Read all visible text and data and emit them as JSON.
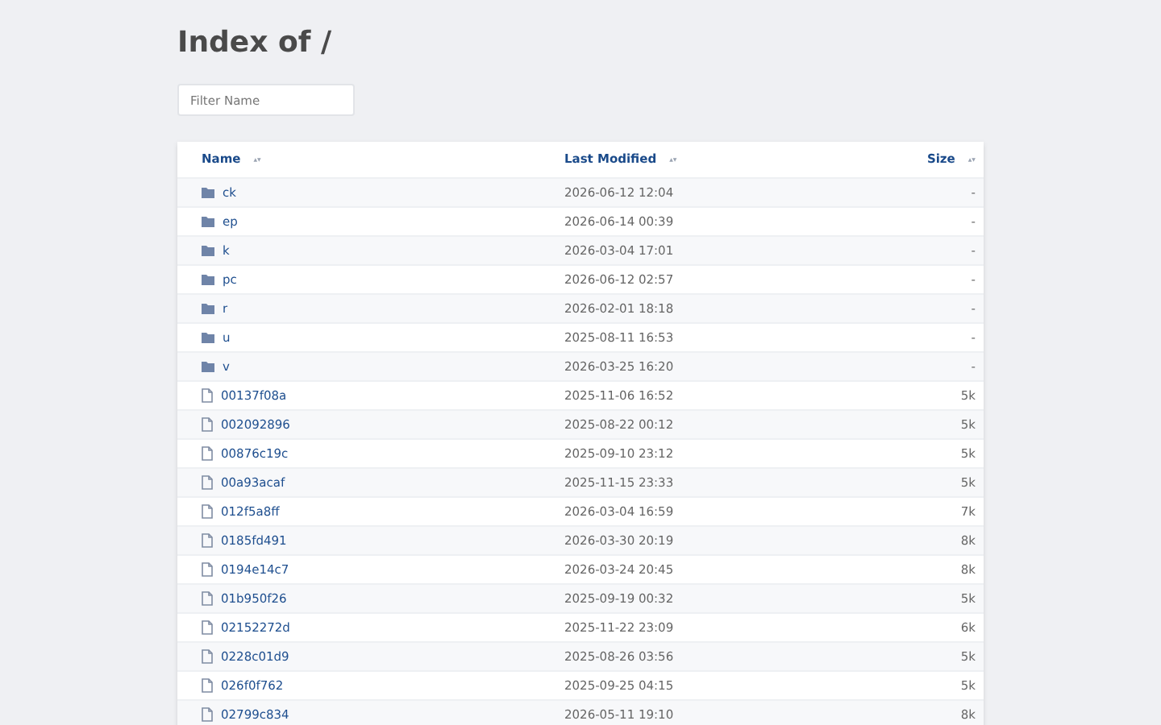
{
  "title": "Index of /",
  "filter": {
    "placeholder": "Filter Name"
  },
  "columns": [
    {
      "label": "Name",
      "sort": "▲▼"
    },
    {
      "label": "Last Modified",
      "sort": "▲▼"
    },
    {
      "label": "Size",
      "sort": "▲▼"
    }
  ],
  "rows": [
    {
      "kind": "folder",
      "name": "ck",
      "modified": "2026-06-12 12:04",
      "size": "-"
    },
    {
      "kind": "folder",
      "name": "ep",
      "modified": "2026-06-14 00:39",
      "size": "-"
    },
    {
      "kind": "folder",
      "name": "k",
      "modified": "2026-03-04 17:01",
      "size": "-"
    },
    {
      "kind": "folder",
      "name": "pc",
      "modified": "2026-06-12 02:57",
      "size": "-"
    },
    {
      "kind": "folder",
      "name": "r",
      "modified": "2026-02-01 18:18",
      "size": "-"
    },
    {
      "kind": "folder",
      "name": "u",
      "modified": "2025-08-11 16:53",
      "size": "-"
    },
    {
      "kind": "folder",
      "name": "v",
      "modified": "2026-03-25 16:20",
      "size": "-"
    },
    {
      "kind": "file",
      "name": "00137f08a",
      "modified": "2025-11-06 16:52",
      "size": "5k"
    },
    {
      "kind": "file",
      "name": "002092896",
      "modified": "2025-08-22 00:12",
      "size": "5k"
    },
    {
      "kind": "file",
      "name": "00876c19c",
      "modified": "2025-09-10 23:12",
      "size": "5k"
    },
    {
      "kind": "file",
      "name": "00a93acaf",
      "modified": "2025-11-15 23:33",
      "size": "5k"
    },
    {
      "kind": "file",
      "name": "012f5a8ff",
      "modified": "2026-03-04 16:59",
      "size": "7k"
    },
    {
      "kind": "file",
      "name": "0185fd491",
      "modified": "2026-03-30 20:19",
      "size": "8k"
    },
    {
      "kind": "file",
      "name": "0194e14c7",
      "modified": "2026-03-24 20:45",
      "size": "8k"
    },
    {
      "kind": "file",
      "name": "01b950f26",
      "modified": "2025-09-19 00:32",
      "size": "5k"
    },
    {
      "kind": "file",
      "name": "02152272d",
      "modified": "2025-11-22 23:09",
      "size": "6k"
    },
    {
      "kind": "file",
      "name": "0228c01d9",
      "modified": "2025-08-26 03:56",
      "size": "5k"
    },
    {
      "kind": "file",
      "name": "026f0f762",
      "modified": "2025-09-25 04:15",
      "size": "5k"
    },
    {
      "kind": "file",
      "name": "02799c834",
      "modified": "2026-05-11 19:10",
      "size": "8k"
    }
  ]
}
